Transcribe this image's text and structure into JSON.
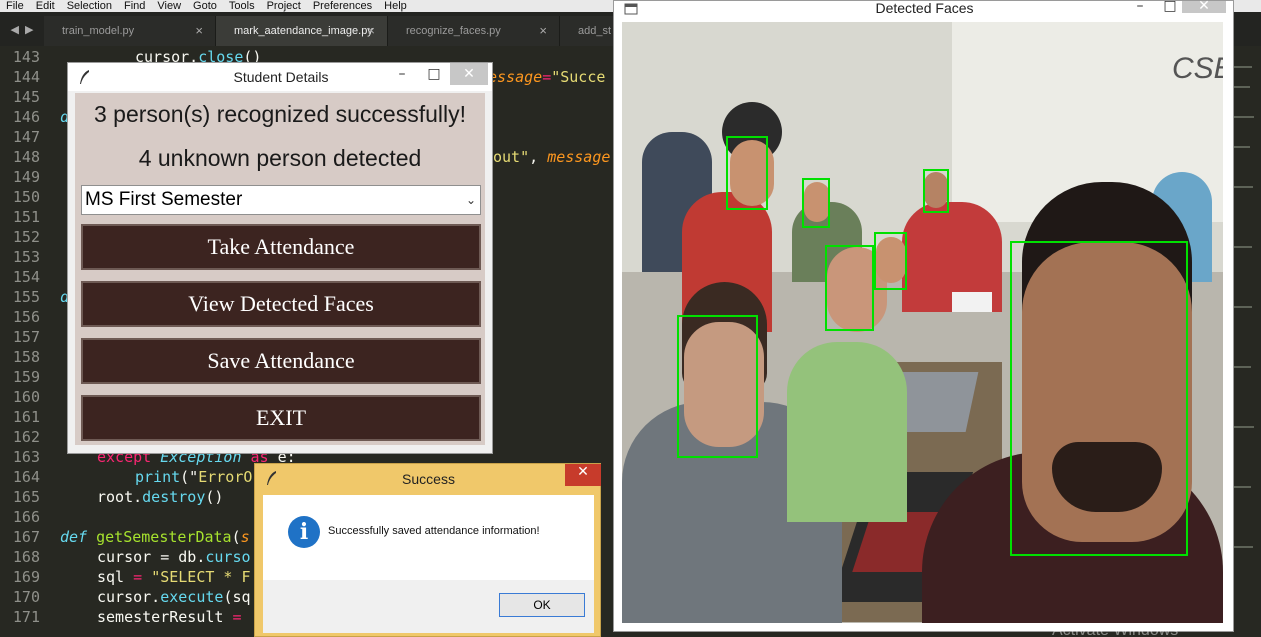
{
  "menubar": {
    "items": [
      "File",
      "Edit",
      "Selection",
      "Find",
      "View",
      "Goto",
      "Tools",
      "Project",
      "Preferences",
      "Help"
    ]
  },
  "editor": {
    "tabs": [
      {
        "label": "train_model.py",
        "active": false
      },
      {
        "label": "mark_aatendance_image.py",
        "active": true
      },
      {
        "label": "recognize_faces.py",
        "active": false
      },
      {
        "label": "add_st",
        "active": false
      }
    ],
    "line_numbers": [
      "143",
      "144",
      "145",
      "146",
      "147",
      "148",
      "149",
      "150",
      "151",
      "152",
      "153",
      "154",
      "155",
      "156",
      "157",
      "158",
      "159",
      "160",
      "161",
      "162",
      "163",
      "164",
      "165",
      "166",
      "167",
      "168",
      "169",
      "170",
      "171"
    ],
    "code": {
      "l143_a": "cursor.",
      "l143_b": "close",
      "l143_c": "()",
      "l144_a": "essage",
      "l144_b": "=",
      "l144_c": "\"Succe",
      "l146": "d",
      "l148_a": "out\"",
      "l148_b": ", ",
      "l148_c": "message",
      "l155": "d",
      "l163_a": "except ",
      "l163_b": "Exception ",
      "l163_c": "as ",
      "l163_d": "e:",
      "l164_a": "print",
      "l164_b": "(\"",
      "l164_c": "ErrorO",
      "l165_a": "root.",
      "l165_b": "destroy",
      "l165_c": "()",
      "l167_a": "def ",
      "l167_b": "getSemesterData",
      "l167_c": "(",
      "l167_d": "s",
      "l168_a": "cursor ",
      "l168_b": "= db.",
      "l168_c": "curso",
      "l169_a": "sql ",
      "l169_b": "= ",
      "l169_c": "\"SELECT * F",
      "l170_a": "cursor.",
      "l170_b": "execute",
      "l170_c": "(sq",
      "l171_a": "semesterResult ",
      "l171_b": "="
    }
  },
  "student_window": {
    "title": "Student Details",
    "recognized_msg": "3 person(s) recognized successfully!",
    "unknown_msg": "4 unknown person detected",
    "semester_selected": "MS First Semester",
    "buttons": {
      "take": "Take Attendance",
      "view": "View Detected Faces",
      "save": "Save Attendance",
      "exit": "EXIT"
    },
    "btn_bg": "#3c2420"
  },
  "success_dialog": {
    "title": "Success",
    "message": "Successfully saved attendance information!",
    "ok_label": "OK",
    "info_glyph": "i"
  },
  "faces_window": {
    "title": "Detected Faces",
    "box_color": "#00e000",
    "wall_text": "CSE"
  },
  "watermark": "Activate Windows"
}
